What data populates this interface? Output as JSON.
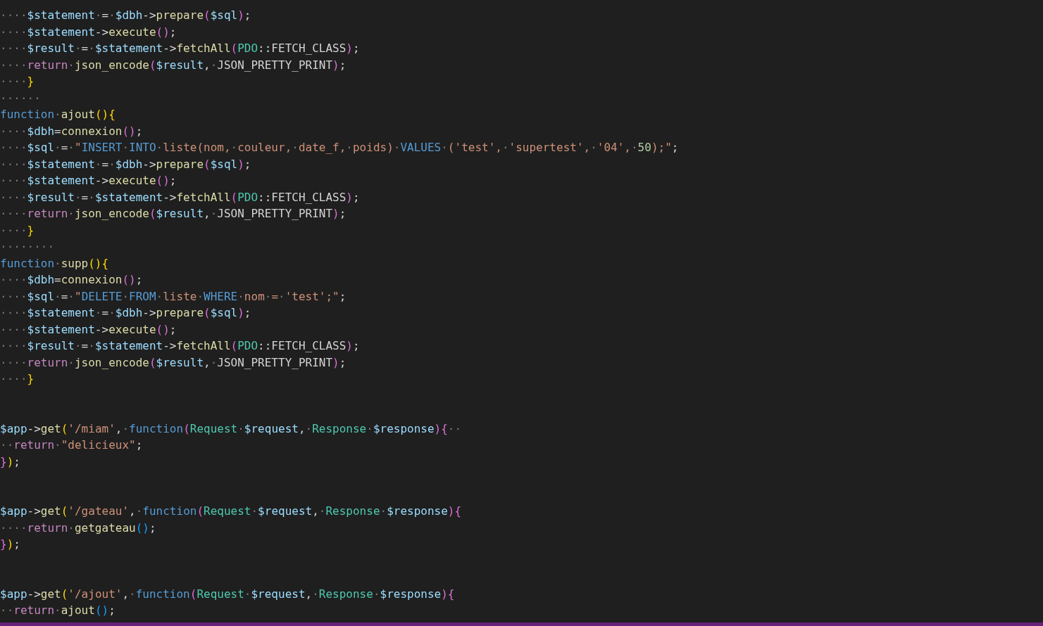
{
  "editor": {
    "lines": [
      {
        "kind": "code",
        "tokens": [
          {
            "kind": "ws",
            "text": "····"
          },
          {
            "kind": "var",
            "text": "$statement"
          },
          {
            "kind": "ws",
            "text": "·"
          },
          {
            "kind": "op",
            "text": "="
          },
          {
            "kind": "ws",
            "text": "·"
          },
          {
            "kind": "var",
            "text": "$dbh"
          },
          {
            "kind": "op",
            "text": "->"
          },
          {
            "kind": "fn",
            "text": "prepare"
          },
          {
            "kind": "b2",
            "text": "("
          },
          {
            "kind": "var",
            "text": "$sql"
          },
          {
            "kind": "b2",
            "text": ")"
          },
          {
            "kind": "op",
            "text": ";"
          }
        ]
      },
      {
        "kind": "code",
        "tokens": [
          {
            "kind": "ws",
            "text": "····"
          },
          {
            "kind": "var",
            "text": "$statement"
          },
          {
            "kind": "op",
            "text": "->"
          },
          {
            "kind": "fn",
            "text": "execute"
          },
          {
            "kind": "b2",
            "text": "()"
          },
          {
            "kind": "op",
            "text": ";"
          }
        ]
      },
      {
        "kind": "code",
        "tokens": [
          {
            "kind": "ws",
            "text": "····"
          },
          {
            "kind": "var",
            "text": "$result"
          },
          {
            "kind": "ws",
            "text": "·"
          },
          {
            "kind": "op",
            "text": "="
          },
          {
            "kind": "ws",
            "text": "·"
          },
          {
            "kind": "var",
            "text": "$statement"
          },
          {
            "kind": "op",
            "text": "->"
          },
          {
            "kind": "fn",
            "text": "fetchAll"
          },
          {
            "kind": "b2",
            "text": "("
          },
          {
            "kind": "type",
            "text": "PDO"
          },
          {
            "kind": "op",
            "text": "::"
          },
          {
            "kind": "const",
            "text": "FETCH_CLASS"
          },
          {
            "kind": "b2",
            "text": ")"
          },
          {
            "kind": "op",
            "text": ";"
          }
        ]
      },
      {
        "kind": "code",
        "tokens": [
          {
            "kind": "ws",
            "text": "····"
          },
          {
            "kind": "ctl",
            "text": "return"
          },
          {
            "kind": "ws",
            "text": "·"
          },
          {
            "kind": "fn",
            "text": "json_encode"
          },
          {
            "kind": "b2",
            "text": "("
          },
          {
            "kind": "var",
            "text": "$result"
          },
          {
            "kind": "op",
            "text": ","
          },
          {
            "kind": "ws",
            "text": "·"
          },
          {
            "kind": "const",
            "text": "JSON_PRETTY_PRINT"
          },
          {
            "kind": "b2",
            "text": ")"
          },
          {
            "kind": "op",
            "text": ";"
          }
        ]
      },
      {
        "kind": "code",
        "tokens": [
          {
            "kind": "ws",
            "text": "····"
          },
          {
            "kind": "b1",
            "text": "}"
          }
        ]
      },
      {
        "kind": "code",
        "tokens": [
          {
            "kind": "ws",
            "text": "······"
          }
        ]
      },
      {
        "kind": "code",
        "tokens": [
          {
            "kind": "kw",
            "text": "function"
          },
          {
            "kind": "ws",
            "text": "·"
          },
          {
            "kind": "fn",
            "text": "ajout"
          },
          {
            "kind": "b1",
            "text": "(){"
          }
        ]
      },
      {
        "kind": "code",
        "tokens": [
          {
            "kind": "ws",
            "text": "····"
          },
          {
            "kind": "var",
            "text": "$dbh"
          },
          {
            "kind": "op",
            "text": "="
          },
          {
            "kind": "fn",
            "text": "connexion"
          },
          {
            "kind": "b2",
            "text": "()"
          },
          {
            "kind": "op",
            "text": ";"
          }
        ]
      },
      {
        "kind": "code",
        "tokens": [
          {
            "kind": "ws",
            "text": "····"
          },
          {
            "kind": "var",
            "text": "$sql"
          },
          {
            "kind": "ws",
            "text": "·"
          },
          {
            "kind": "op",
            "text": "="
          },
          {
            "kind": "ws",
            "text": "·"
          },
          {
            "kind": "str",
            "text": "\""
          },
          {
            "kind": "sql",
            "text": "INSERT"
          },
          {
            "kind": "ws",
            "text": "·"
          },
          {
            "kind": "sql",
            "text": "INTO"
          },
          {
            "kind": "ws",
            "text": "·"
          },
          {
            "kind": "str",
            "text": "liste(nom,"
          },
          {
            "kind": "ws",
            "text": "·"
          },
          {
            "kind": "str",
            "text": "couleur,"
          },
          {
            "kind": "ws",
            "text": "·"
          },
          {
            "kind": "str",
            "text": "date_f,"
          },
          {
            "kind": "ws",
            "text": "·"
          },
          {
            "kind": "str",
            "text": "poids)"
          },
          {
            "kind": "ws",
            "text": "·"
          },
          {
            "kind": "sql",
            "text": "VALUES"
          },
          {
            "kind": "ws",
            "text": "·"
          },
          {
            "kind": "str",
            "text": "('test',"
          },
          {
            "kind": "ws",
            "text": "·"
          },
          {
            "kind": "str",
            "text": "'supertest',"
          },
          {
            "kind": "ws",
            "text": "·"
          },
          {
            "kind": "str",
            "text": "'04',"
          },
          {
            "kind": "ws",
            "text": "·"
          },
          {
            "kind": "num",
            "text": "50"
          },
          {
            "kind": "str",
            "text": ");\""
          },
          {
            "kind": "op",
            "text": ";"
          }
        ]
      },
      {
        "kind": "code",
        "tokens": [
          {
            "kind": "ws",
            "text": "····"
          },
          {
            "kind": "var",
            "text": "$statement"
          },
          {
            "kind": "ws",
            "text": "·"
          },
          {
            "kind": "op",
            "text": "="
          },
          {
            "kind": "ws",
            "text": "·"
          },
          {
            "kind": "var",
            "text": "$dbh"
          },
          {
            "kind": "op",
            "text": "->"
          },
          {
            "kind": "fn",
            "text": "prepare"
          },
          {
            "kind": "b2",
            "text": "("
          },
          {
            "kind": "var",
            "text": "$sql"
          },
          {
            "kind": "b2",
            "text": ")"
          },
          {
            "kind": "op",
            "text": ";"
          }
        ]
      },
      {
        "kind": "code",
        "tokens": [
          {
            "kind": "ws",
            "text": "····"
          },
          {
            "kind": "var",
            "text": "$statement"
          },
          {
            "kind": "op",
            "text": "->"
          },
          {
            "kind": "fn",
            "text": "execute"
          },
          {
            "kind": "b2",
            "text": "()"
          },
          {
            "kind": "op",
            "text": ";"
          }
        ]
      },
      {
        "kind": "code",
        "tokens": [
          {
            "kind": "ws",
            "text": "····"
          },
          {
            "kind": "var",
            "text": "$result"
          },
          {
            "kind": "ws",
            "text": "·"
          },
          {
            "kind": "op",
            "text": "="
          },
          {
            "kind": "ws",
            "text": "·"
          },
          {
            "kind": "var",
            "text": "$statement"
          },
          {
            "kind": "op",
            "text": "->"
          },
          {
            "kind": "fn",
            "text": "fetchAll"
          },
          {
            "kind": "b2",
            "text": "("
          },
          {
            "kind": "type",
            "text": "PDO"
          },
          {
            "kind": "op",
            "text": "::"
          },
          {
            "kind": "const",
            "text": "FETCH_CLASS"
          },
          {
            "kind": "b2",
            "text": ")"
          },
          {
            "kind": "op",
            "text": ";"
          }
        ]
      },
      {
        "kind": "code",
        "tokens": [
          {
            "kind": "ws",
            "text": "····"
          },
          {
            "kind": "ctl",
            "text": "return"
          },
          {
            "kind": "ws",
            "text": "·"
          },
          {
            "kind": "fn",
            "text": "json_encode"
          },
          {
            "kind": "b2",
            "text": "("
          },
          {
            "kind": "var",
            "text": "$result"
          },
          {
            "kind": "op",
            "text": ","
          },
          {
            "kind": "ws",
            "text": "·"
          },
          {
            "kind": "const",
            "text": "JSON_PRETTY_PRINT"
          },
          {
            "kind": "b2",
            "text": ")"
          },
          {
            "kind": "op",
            "text": ";"
          }
        ]
      },
      {
        "kind": "code",
        "tokens": [
          {
            "kind": "ws",
            "text": "····"
          },
          {
            "kind": "b1",
            "text": "}"
          }
        ]
      },
      {
        "kind": "code",
        "tokens": [
          {
            "kind": "ws",
            "text": "········"
          }
        ]
      },
      {
        "kind": "code",
        "tokens": [
          {
            "kind": "kw",
            "text": "function"
          },
          {
            "kind": "ws",
            "text": "·"
          },
          {
            "kind": "fn",
            "text": "supp"
          },
          {
            "kind": "b1",
            "text": "(){"
          }
        ]
      },
      {
        "kind": "code",
        "tokens": [
          {
            "kind": "ws",
            "text": "····"
          },
          {
            "kind": "var",
            "text": "$dbh"
          },
          {
            "kind": "op",
            "text": "="
          },
          {
            "kind": "fn",
            "text": "connexion"
          },
          {
            "kind": "b2",
            "text": "()"
          },
          {
            "kind": "op",
            "text": ";"
          }
        ]
      },
      {
        "kind": "code",
        "tokens": [
          {
            "kind": "ws",
            "text": "····"
          },
          {
            "kind": "var",
            "text": "$sql"
          },
          {
            "kind": "ws",
            "text": "·"
          },
          {
            "kind": "op",
            "text": "="
          },
          {
            "kind": "ws",
            "text": "·"
          },
          {
            "kind": "str",
            "text": "\""
          },
          {
            "kind": "sql",
            "text": "DELETE"
          },
          {
            "kind": "ws",
            "text": "·"
          },
          {
            "kind": "sql",
            "text": "FROM"
          },
          {
            "kind": "ws",
            "text": "·"
          },
          {
            "kind": "str",
            "text": "liste"
          },
          {
            "kind": "ws",
            "text": "·"
          },
          {
            "kind": "sql",
            "text": "WHERE"
          },
          {
            "kind": "ws",
            "text": "·"
          },
          {
            "kind": "str",
            "text": "nom"
          },
          {
            "kind": "ws",
            "text": "·"
          },
          {
            "kind": "str",
            "text": "="
          },
          {
            "kind": "ws",
            "text": "·"
          },
          {
            "kind": "str",
            "text": "'test';\""
          },
          {
            "kind": "op",
            "text": ";"
          }
        ]
      },
      {
        "kind": "code",
        "tokens": [
          {
            "kind": "ws",
            "text": "····"
          },
          {
            "kind": "var",
            "text": "$statement"
          },
          {
            "kind": "ws",
            "text": "·"
          },
          {
            "kind": "op",
            "text": "="
          },
          {
            "kind": "ws",
            "text": "·"
          },
          {
            "kind": "var",
            "text": "$dbh"
          },
          {
            "kind": "op",
            "text": "->"
          },
          {
            "kind": "fn",
            "text": "prepare"
          },
          {
            "kind": "b2",
            "text": "("
          },
          {
            "kind": "var",
            "text": "$sql"
          },
          {
            "kind": "b2",
            "text": ")"
          },
          {
            "kind": "op",
            "text": ";"
          }
        ]
      },
      {
        "kind": "code",
        "tokens": [
          {
            "kind": "ws",
            "text": "····"
          },
          {
            "kind": "var",
            "text": "$statement"
          },
          {
            "kind": "op",
            "text": "->"
          },
          {
            "kind": "fn",
            "text": "execute"
          },
          {
            "kind": "b2",
            "text": "()"
          },
          {
            "kind": "op",
            "text": ";"
          }
        ]
      },
      {
        "kind": "code",
        "tokens": [
          {
            "kind": "ws",
            "text": "····"
          },
          {
            "kind": "var",
            "text": "$result"
          },
          {
            "kind": "ws",
            "text": "·"
          },
          {
            "kind": "op",
            "text": "="
          },
          {
            "kind": "ws",
            "text": "·"
          },
          {
            "kind": "var",
            "text": "$statement"
          },
          {
            "kind": "op",
            "text": "->"
          },
          {
            "kind": "fn",
            "text": "fetchAll"
          },
          {
            "kind": "b2",
            "text": "("
          },
          {
            "kind": "type",
            "text": "PDO"
          },
          {
            "kind": "op",
            "text": "::"
          },
          {
            "kind": "const",
            "text": "FETCH_CLASS"
          },
          {
            "kind": "b2",
            "text": ")"
          },
          {
            "kind": "op",
            "text": ";"
          }
        ]
      },
      {
        "kind": "code",
        "tokens": [
          {
            "kind": "ws",
            "text": "····"
          },
          {
            "kind": "ctl",
            "text": "return"
          },
          {
            "kind": "ws",
            "text": "·"
          },
          {
            "kind": "fn",
            "text": "json_encode"
          },
          {
            "kind": "b2",
            "text": "("
          },
          {
            "kind": "var",
            "text": "$result"
          },
          {
            "kind": "op",
            "text": ","
          },
          {
            "kind": "ws",
            "text": "·"
          },
          {
            "kind": "const",
            "text": "JSON_PRETTY_PRINT"
          },
          {
            "kind": "b2",
            "text": ")"
          },
          {
            "kind": "op",
            "text": ";"
          }
        ]
      },
      {
        "kind": "code",
        "tokens": [
          {
            "kind": "ws",
            "text": "····"
          },
          {
            "kind": "b1",
            "text": "}"
          }
        ]
      },
      {
        "kind": "blank"
      },
      {
        "kind": "blank"
      },
      {
        "kind": "code",
        "tokens": [
          {
            "kind": "var",
            "text": "$app"
          },
          {
            "kind": "op",
            "text": "->"
          },
          {
            "kind": "fn",
            "text": "get"
          },
          {
            "kind": "b1",
            "text": "("
          },
          {
            "kind": "str",
            "text": "'/miam'"
          },
          {
            "kind": "op",
            "text": ","
          },
          {
            "kind": "ws",
            "text": "·"
          },
          {
            "kind": "kw",
            "text": "function"
          },
          {
            "kind": "b2",
            "text": "("
          },
          {
            "kind": "type",
            "text": "Request"
          },
          {
            "kind": "ws",
            "text": "·"
          },
          {
            "kind": "var",
            "text": "$request"
          },
          {
            "kind": "op",
            "text": ","
          },
          {
            "kind": "ws",
            "text": "·"
          },
          {
            "kind": "type",
            "text": "Response"
          },
          {
            "kind": "ws",
            "text": "·"
          },
          {
            "kind": "var",
            "text": "$response"
          },
          {
            "kind": "b2",
            "text": "){"
          },
          {
            "kind": "ws",
            "text": "··"
          }
        ]
      },
      {
        "kind": "code",
        "tokens": [
          {
            "kind": "ws",
            "text": "··"
          },
          {
            "kind": "ctl",
            "text": "return"
          },
          {
            "kind": "ws",
            "text": "·"
          },
          {
            "kind": "str",
            "text": "\"delicieux\""
          },
          {
            "kind": "op",
            "text": ";"
          }
        ]
      },
      {
        "kind": "code",
        "tokens": [
          {
            "kind": "b2",
            "text": "}"
          },
          {
            "kind": "b1",
            "text": ")"
          },
          {
            "kind": "op",
            "text": ";"
          }
        ]
      },
      {
        "kind": "blank"
      },
      {
        "kind": "blank"
      },
      {
        "kind": "code",
        "tokens": [
          {
            "kind": "var",
            "text": "$app"
          },
          {
            "kind": "op",
            "text": "->"
          },
          {
            "kind": "fn",
            "text": "get"
          },
          {
            "kind": "b1",
            "text": "("
          },
          {
            "kind": "str",
            "text": "'/gateau'"
          },
          {
            "kind": "op",
            "text": ","
          },
          {
            "kind": "ws",
            "text": "·"
          },
          {
            "kind": "kw",
            "text": "function"
          },
          {
            "kind": "b2",
            "text": "("
          },
          {
            "kind": "type",
            "text": "Request"
          },
          {
            "kind": "ws",
            "text": "·"
          },
          {
            "kind": "var",
            "text": "$request"
          },
          {
            "kind": "op",
            "text": ","
          },
          {
            "kind": "ws",
            "text": "·"
          },
          {
            "kind": "type",
            "text": "Response"
          },
          {
            "kind": "ws",
            "text": "·"
          },
          {
            "kind": "var",
            "text": "$response"
          },
          {
            "kind": "b2",
            "text": "){"
          }
        ]
      },
      {
        "kind": "code",
        "tokens": [
          {
            "kind": "ws",
            "text": "····"
          },
          {
            "kind": "ctl",
            "text": "return"
          },
          {
            "kind": "ws",
            "text": "·"
          },
          {
            "kind": "fn",
            "text": "getgateau"
          },
          {
            "kind": "b3",
            "text": "()"
          },
          {
            "kind": "op",
            "text": ";"
          }
        ]
      },
      {
        "kind": "code",
        "tokens": [
          {
            "kind": "b2",
            "text": "}"
          },
          {
            "kind": "b1",
            "text": ")"
          },
          {
            "kind": "op",
            "text": ";"
          }
        ]
      },
      {
        "kind": "blank"
      },
      {
        "kind": "blank"
      },
      {
        "kind": "code",
        "tokens": [
          {
            "kind": "var",
            "text": "$app"
          },
          {
            "kind": "op",
            "text": "->"
          },
          {
            "kind": "fn",
            "text": "get"
          },
          {
            "kind": "b1",
            "text": "("
          },
          {
            "kind": "str",
            "text": "'/ajout'"
          },
          {
            "kind": "op",
            "text": ","
          },
          {
            "kind": "ws",
            "text": "·"
          },
          {
            "kind": "kw",
            "text": "function"
          },
          {
            "kind": "b2",
            "text": "("
          },
          {
            "kind": "type",
            "text": "Request"
          },
          {
            "kind": "ws",
            "text": "·"
          },
          {
            "kind": "var",
            "text": "$request"
          },
          {
            "kind": "op",
            "text": ","
          },
          {
            "kind": "ws",
            "text": "·"
          },
          {
            "kind": "type",
            "text": "Response"
          },
          {
            "kind": "ws",
            "text": "·"
          },
          {
            "kind": "var",
            "text": "$response"
          },
          {
            "kind": "b2",
            "text": "){"
          }
        ]
      },
      {
        "kind": "code",
        "tokens": [
          {
            "kind": "ws",
            "text": "··"
          },
          {
            "kind": "ctl",
            "text": "return"
          },
          {
            "kind": "ws",
            "text": "·"
          },
          {
            "kind": "fn",
            "text": "ajout"
          },
          {
            "kind": "b3",
            "text": "()"
          },
          {
            "kind": "op",
            "text": ";"
          }
        ]
      }
    ]
  }
}
